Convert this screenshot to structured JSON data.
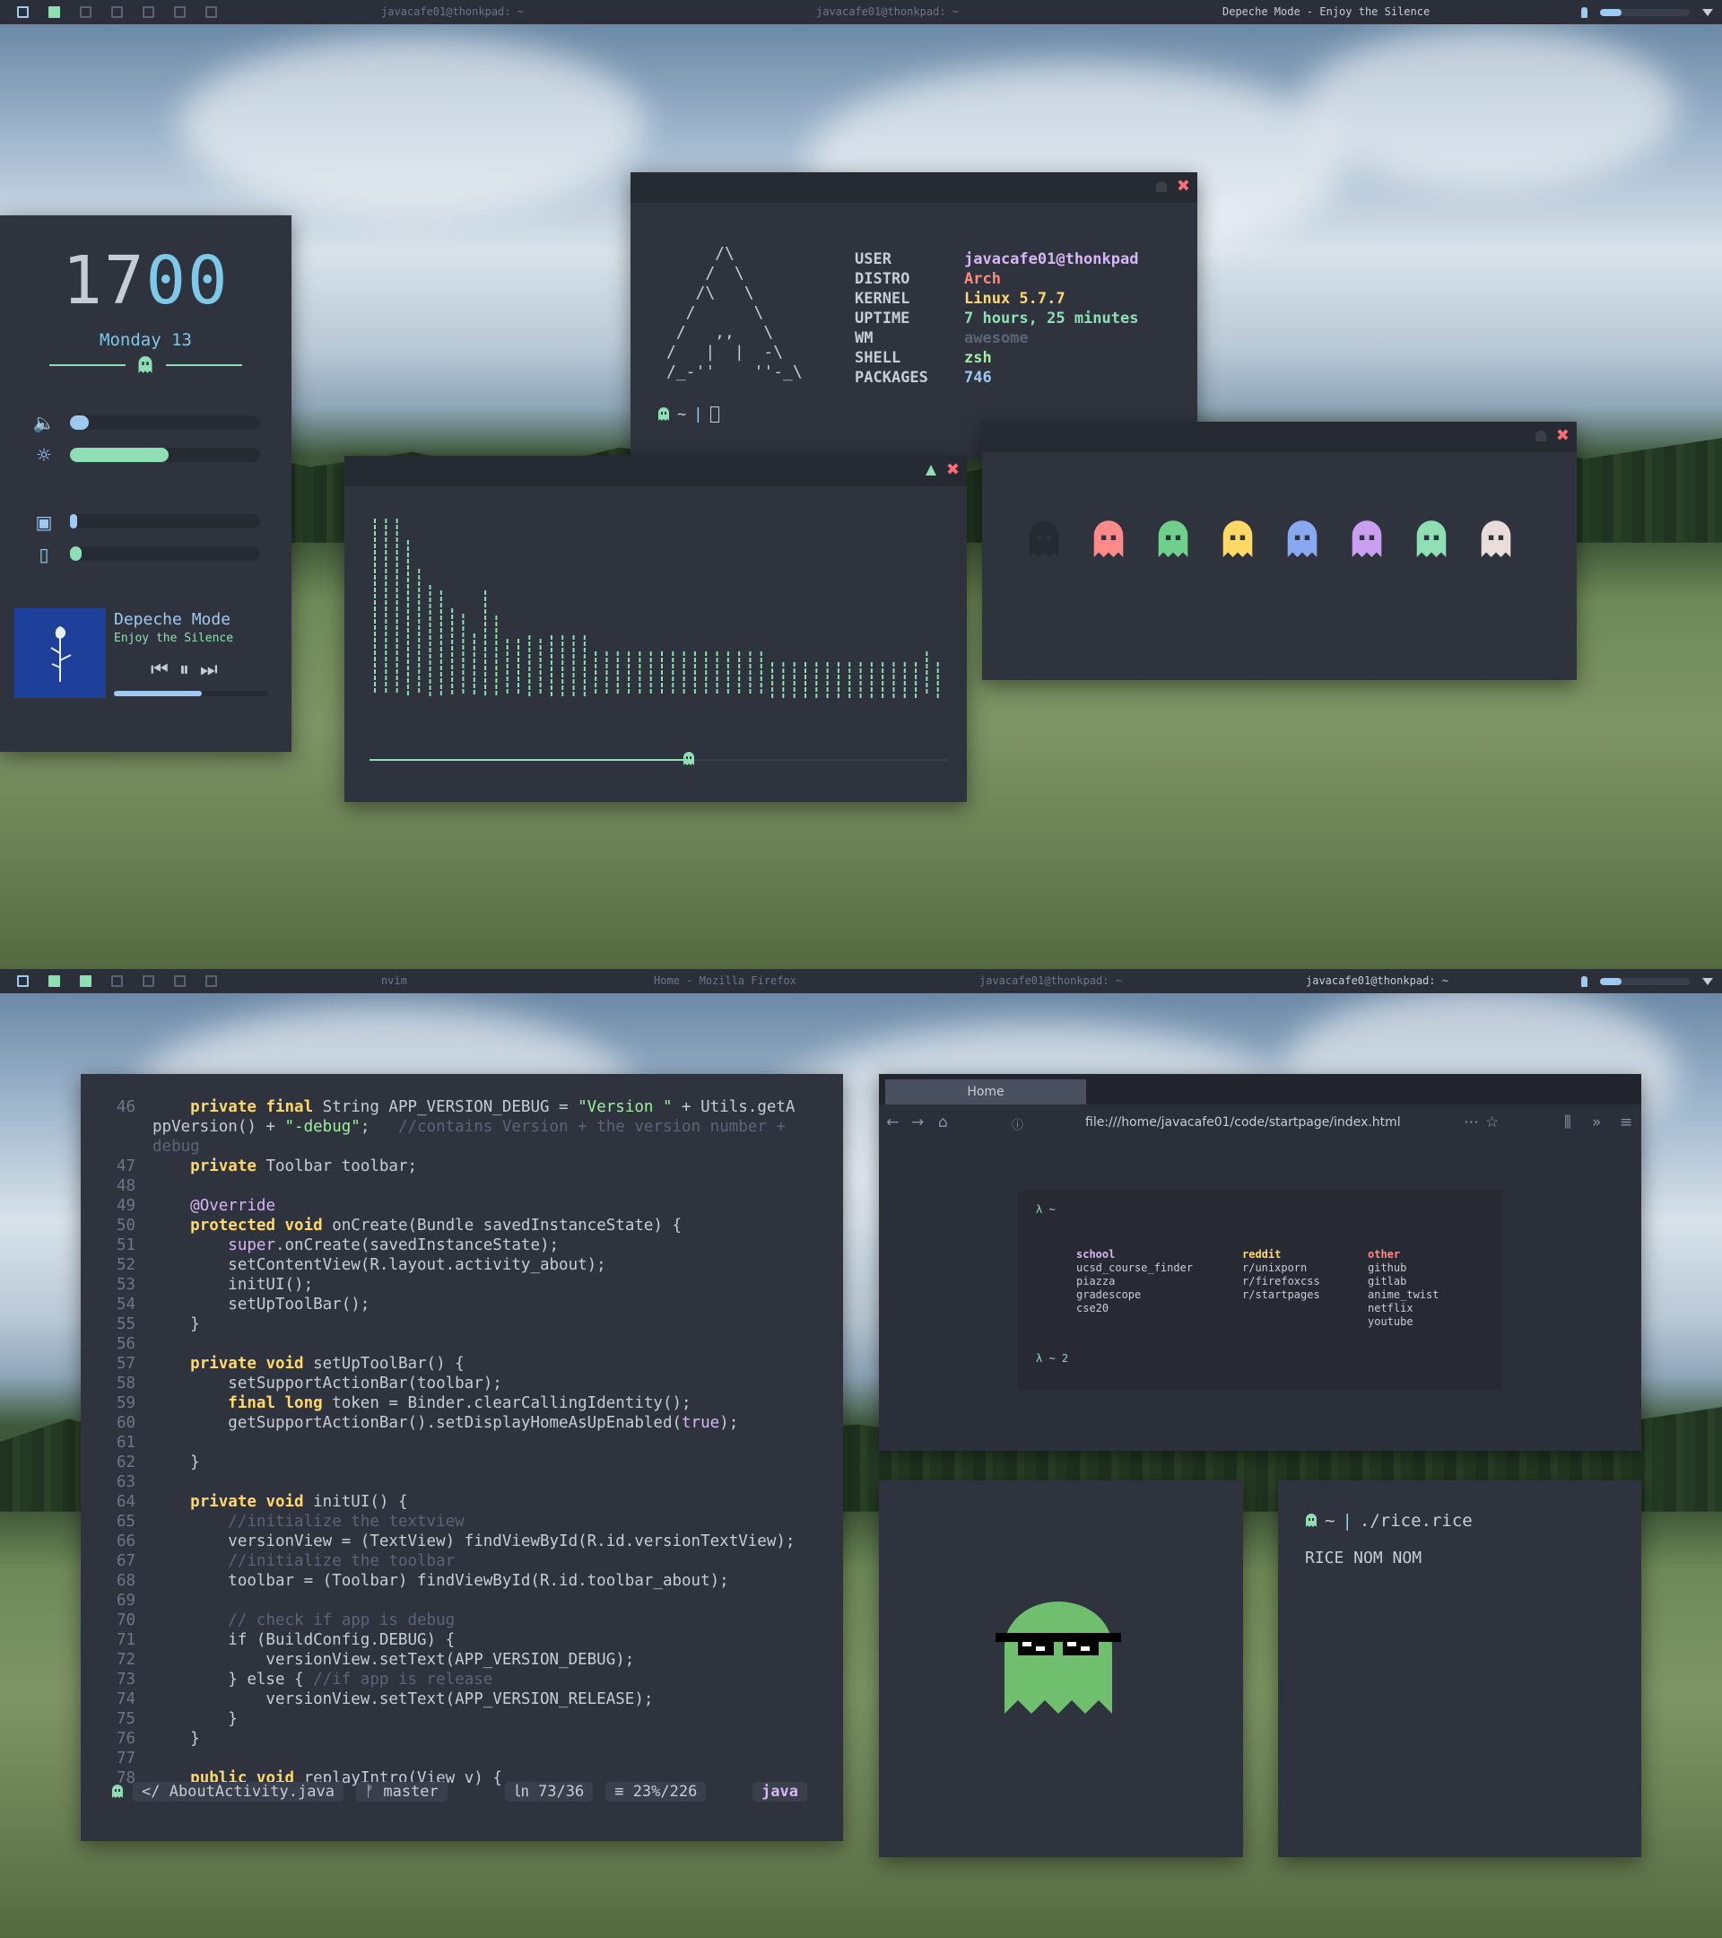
{
  "screen1": {
    "bar": {
      "tasks": [
        {
          "label": "javacafe01@thonkpad: ~",
          "active": false
        },
        {
          "label": "javacafe01@thonkpad: ~",
          "active": false
        },
        {
          "label": "Depeche Mode - Enjoy the Silence",
          "active": true
        }
      ],
      "volume_fraction": 0.24
    },
    "sidebar": {
      "clock_hours": "17",
      "clock_minutes": "00",
      "date": "Monday 13",
      "volume_fraction": 0.1,
      "brightness_fraction": 0.52,
      "cpu_fraction": 0.02,
      "ram_fraction": 0.06,
      "artist": "Depeche Mode",
      "song": "Enjoy the Silence",
      "progress_fraction": 0.57,
      "icons": [
        "volume-icon",
        "brightness-icon",
        "cpu-icon",
        "memory-icon",
        "ghost-icon"
      ]
    },
    "fetch": {
      "logo_art": "     /\\\n    /  \\\n   /\\   \\\n  /      \\\n /   ,,   \\\n/   |  |  -\\\n/_-''    ''-_\\",
      "rows": [
        {
          "key": "USER",
          "value": "javacafe01@thonkpad",
          "color": "#d7b6f5"
        },
        {
          "key": "DISTRO",
          "value": "Arch",
          "color": "#ff8a7a"
        },
        {
          "key": "KERNEL",
          "value": "Linux 5.7.7",
          "color": "#ffd866"
        },
        {
          "key": "UPTIME",
          "value": "7 hours, 25 minutes",
          "color": "#8ee0b4"
        },
        {
          "key": "WM",
          "value": "awesome",
          "color": "#5c6478"
        },
        {
          "key": "SHELL",
          "value": "zsh",
          "color": "#9ef0a0"
        },
        {
          "key": "PACKAGES",
          "value": "746",
          "color": "#9ec9f0"
        }
      ],
      "prompt": "~"
    },
    "visualizer": {
      "levels": [
        100,
        100,
        100,
        88,
        72,
        63,
        60,
        50,
        47,
        36,
        60,
        46,
        33,
        33,
        35,
        33,
        35,
        35,
        35,
        35,
        26,
        26,
        26,
        26,
        26,
        26,
        26,
        26,
        26,
        26,
        26,
        26,
        26,
        26,
        26,
        26,
        20,
        20,
        20,
        20,
        20,
        20,
        20,
        20,
        20,
        20,
        20,
        20,
        20,
        20,
        26,
        20
      ],
      "progress_fraction": 0.55
    },
    "ghosts": {
      "colors": [
        "#262a33",
        "#ff8a8a",
        "#6fd08c",
        "#ffd866",
        "#8aa8f0",
        "#c9a0f0",
        "#8ee0b4",
        "#e8ddd8"
      ]
    }
  },
  "screen2": {
    "bar": {
      "tasks": [
        {
          "label": "nvim",
          "active": false
        },
        {
          "label": "Home - Mozilla Firefox",
          "active": false
        },
        {
          "label": "javacafe01@thonkpad: ~",
          "active": false
        },
        {
          "label": "javacafe01@thonkpad: ~",
          "active": true
        }
      ],
      "volume_fraction": 0.24
    },
    "editor": {
      "lines": [
        {
          "n": "46",
          "html": "    <span class='kw'>private final</span> String APP_VERSION_DEBUG = <span class='st'>\"Version \"</span> + Utils.getA"
        },
        {
          "n": "",
          "html": "ppVersion() + <span class='st'>\"-debug\"</span>;   <span class='cm'>//contains Version + the version number +</span>"
        },
        {
          "n": "",
          "html": "<span class='cm'>debug</span>"
        },
        {
          "n": "47",
          "html": "    <span class='kw'>private</span> Toolbar toolbar;"
        },
        {
          "n": "48",
          "html": ""
        },
        {
          "n": "49",
          "html": "    <span class='ann'>@Override</span>"
        },
        {
          "n": "50",
          "html": "    <span class='kw'>protected void</span> onCreate(Bundle savedInstanceState) {"
        },
        {
          "n": "51",
          "html": "        <span class='ann'>super</span>.onCreate(savedInstanceState);"
        },
        {
          "n": "52",
          "html": "        setContentView(R.layout.activity_about);"
        },
        {
          "n": "53",
          "html": "        initUI();"
        },
        {
          "n": "54",
          "html": "        setUpToolBar();"
        },
        {
          "n": "55",
          "html": "    }"
        },
        {
          "n": "56",
          "html": ""
        },
        {
          "n": "57",
          "html": "    <span class='kw'>private void</span> setUpToolBar() {"
        },
        {
          "n": "58",
          "html": "        setSupportActionBar(toolbar);"
        },
        {
          "n": "59",
          "html": "        <span class='kw'>final long</span> token = Binder.clearCallingIdentity();"
        },
        {
          "n": "60",
          "html": "        getSupportActionBar().setDisplayHomeAsUpEnabled(<span class='ann'>true</span>);"
        },
        {
          "n": "61",
          "html": ""
        },
        {
          "n": "62",
          "html": "    }"
        },
        {
          "n": "63",
          "html": ""
        },
        {
          "n": "64",
          "html": "    <span class='kw'>private void</span> initUI() {"
        },
        {
          "n": "65",
          "html": "        <span class='cm'>//initialize the textview</span>"
        },
        {
          "n": "66",
          "html": "        versionView = (TextView) findViewById(R.id.versionTextView);"
        },
        {
          "n": "67",
          "html": "        <span class='cm'>//initialize the toolbar</span>"
        },
        {
          "n": "68",
          "html": "        toolbar = (Toolbar) findViewById(R.id.toolbar_about);"
        },
        {
          "n": "69",
          "html": ""
        },
        {
          "n": "70",
          "html": "        <span class='cm'>// check if app is debug</span>"
        },
        {
          "n": "71",
          "html": "        if (BuildConfig.DEBUG) {"
        },
        {
          "n": "72",
          "html": "            versionView.setText(APP_VERSION_DEBUG);"
        },
        {
          "n": "73",
          "html": "        } else { <span class='cm'>//if app is release</span>"
        },
        {
          "n": "74",
          "html": "            versionView.setText(APP_VERSION_RELEASE);"
        },
        {
          "n": "75",
          "html": "        }"
        },
        {
          "n": "76",
          "html": "    }"
        },
        {
          "n": "77",
          "html": ""
        },
        {
          "n": "78",
          "html": "    <span class='kw'>public void</span> replayIntro(View v) {"
        }
      ],
      "status": {
        "file": "</ AboutActivity.java",
        "branch": "ᚠ master",
        "position": "㏑ 73/36",
        "percent": "≡ 23%/226",
        "filetype": "java"
      }
    },
    "browser": {
      "tab": "Home",
      "url": "file:///home/javacafe01/code/startpage/index.html",
      "prompt_top": "λ  ~",
      "prompt_bottom": "λ  ~  2",
      "columns": [
        {
          "heading": "school",
          "color": "#d7b6f5",
          "items": [
            "ucsd_course_finder",
            "piazza",
            "gradescope",
            "cse20"
          ]
        },
        {
          "heading": "reddit",
          "color": "#ffd866",
          "items": [
            "r/unixporn",
            "r/firefoxcss",
            "r/startpages"
          ]
        },
        {
          "heading": "other",
          "color": "#ff8a8a",
          "items": [
            "github",
            "gitlab",
            "anime_twist",
            "netflix",
            "youtube"
          ]
        }
      ]
    },
    "rice": {
      "command": "./rice.rice",
      "output": "RICE NOM NOM",
      "prompt": "~"
    }
  }
}
